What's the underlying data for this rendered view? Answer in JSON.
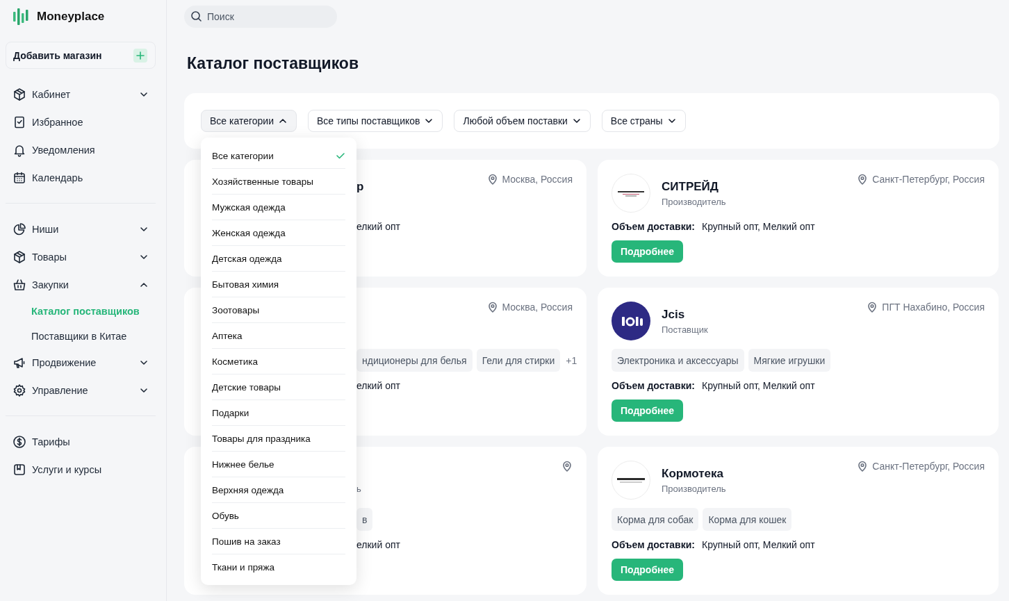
{
  "brand": {
    "name": "Moneyplace"
  },
  "add_store": {
    "label": "Добавить магазин"
  },
  "nav": [
    {
      "items": [
        {
          "label": "Кабинет",
          "expanded": false
        },
        {
          "label": "Избранное"
        },
        {
          "label": "Уведомления"
        },
        {
          "label": "Календарь"
        }
      ]
    },
    {
      "items": [
        {
          "label": "Ниши",
          "expanded": false
        },
        {
          "label": "Товары",
          "expanded": false
        },
        {
          "label": "Закупки",
          "expanded": true,
          "children": [
            {
              "label": "Каталог поставщиков",
              "selected": true
            },
            {
              "label": "Поставщики в Китае",
              "selected": false
            }
          ]
        },
        {
          "label": "Продвижение",
          "expanded": false
        },
        {
          "label": "Управление",
          "expanded": false
        }
      ]
    },
    {
      "items": [
        {
          "label": "Тарифы"
        },
        {
          "label": "Услуги и курсы"
        }
      ]
    }
  ],
  "search": {
    "placeholder": "Поиск"
  },
  "title": "Каталог поставщиков",
  "filters": [
    {
      "label": "Все категории",
      "expanded": true,
      "options": [
        {
          "label": "Все категории",
          "selected": true
        },
        {
          "label": "Хозяйственные товары",
          "selected": false
        },
        {
          "label": "Мужская одежда",
          "selected": false
        },
        {
          "label": "Женская одежда",
          "selected": false
        },
        {
          "label": "Детская одежда",
          "selected": false
        },
        {
          "label": "Бытовая химия",
          "selected": false
        },
        {
          "label": "Зоотовары",
          "selected": false
        },
        {
          "label": "Аптека",
          "selected": false
        },
        {
          "label": "Косметика",
          "selected": false
        },
        {
          "label": "Детские товары",
          "selected": false
        },
        {
          "label": "Подарки",
          "selected": false
        },
        {
          "label": "Товары для праздника",
          "selected": false
        },
        {
          "label": "Нижнее белье",
          "selected": false
        },
        {
          "label": "Верхняя одежда",
          "selected": false
        },
        {
          "label": "Обувь",
          "selected": false
        },
        {
          "label": "Пошив на заказ",
          "selected": false
        },
        {
          "label": "Ткани и пряжа",
          "selected": false
        }
      ]
    },
    {
      "label": "Все типы поставщиков",
      "expanded": false
    },
    {
      "label": "Любой объем поставки",
      "expanded": false
    },
    {
      "label": "Все страны",
      "expanded": false
    }
  ],
  "card_columns": [
    {
      "cards": [
        {
          "covered": true,
          "name": "р",
          "location": "Москва, Россия",
          "delivery": "елкий опт"
        },
        {
          "covered": true,
          "location": "Москва, Россия",
          "tags": [
            "ндиционеры для белья",
            "Гели для стирки"
          ],
          "more": "+1",
          "delivery": "елкий опт"
        },
        {
          "covered": true,
          "type": "ь",
          "tags": [
            "в"
          ],
          "delivery": "елкий опт"
        }
      ]
    },
    {
      "cards": [
        {
          "covered": false,
          "name": "СИТРЕЙД",
          "type": "Производитель",
          "location": "Санкт-Петербург, Россия",
          "delivery_label": "Объем доставки:",
          "delivery": "Крупный опт, Мелкий опт",
          "button": "Подробнее"
        },
        {
          "covered": false,
          "name": "Jcis",
          "type": "Поставщик",
          "location": "ПГТ Нахабино, Россия",
          "tags": [
            "Электроника и аксессуары",
            "Мягкие игрушки"
          ],
          "delivery_label": "Объем доставки:",
          "delivery": "Крупный опт, Мелкий опт",
          "button": "Подробнее"
        },
        {
          "covered": false,
          "name": "Кормотека",
          "type": "Производитель",
          "location": "Санкт-Петербург, Россия",
          "tags": [
            "Корма для собак",
            "Корма для кошек"
          ],
          "delivery_label": "Объем доставки:",
          "delivery": "Крупный опт, Мелкий опт",
          "button": "Подробнее"
        }
      ]
    }
  ]
}
